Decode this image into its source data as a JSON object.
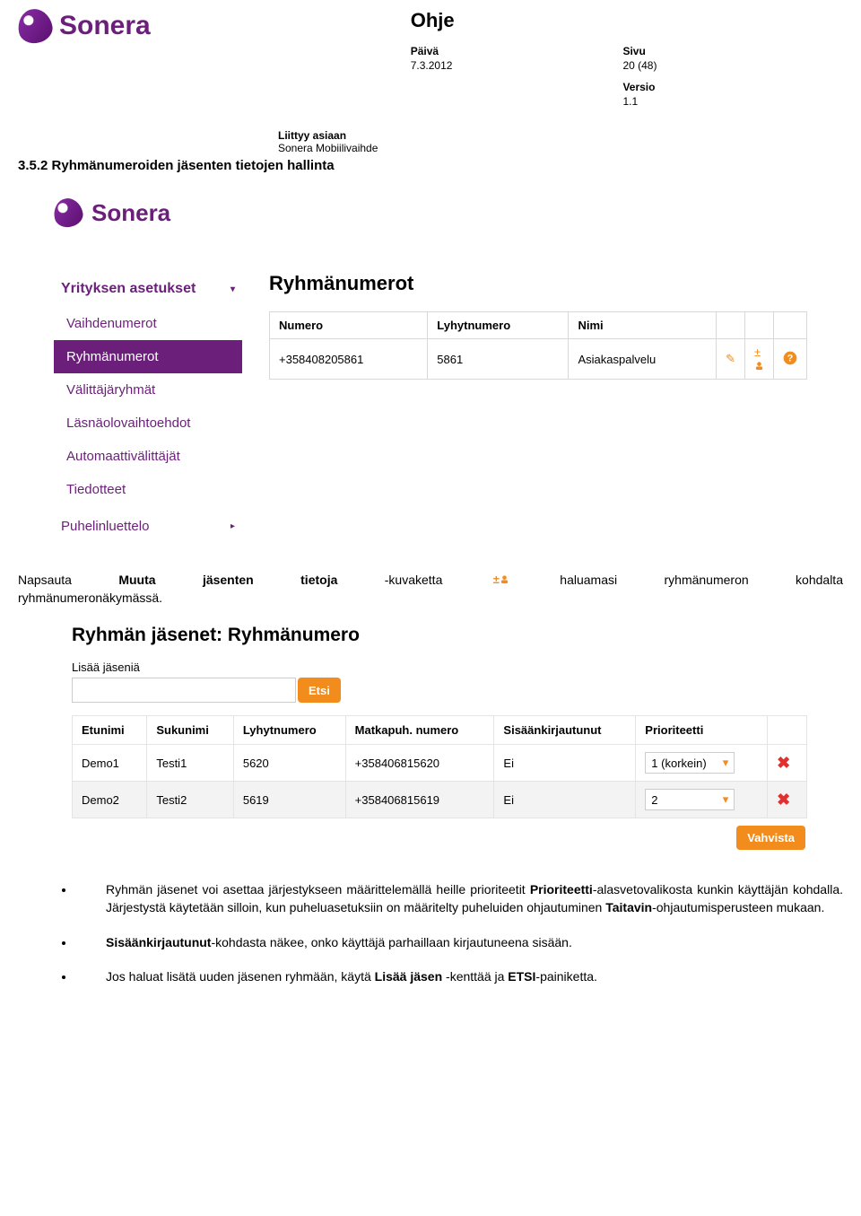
{
  "header": {
    "brand": "Sonera",
    "doc_title": "Ohje",
    "date_label": "Päivä",
    "date_value": "7.3.2012",
    "page_label": "Sivu",
    "page_value": "20 (48)",
    "version_label": "Versio",
    "version_value": "1.1",
    "relates_label": "Liittyy asiaan",
    "relates_value": "Sonera Mobiilivaihde"
  },
  "section_number": "3.5.2 Ryhmänumeroiden jäsenten tietojen hallinta",
  "shot1": {
    "brand": "Sonera",
    "sidebar_header": "Yrityksen asetukset",
    "sidebar_footer": "Puhelinluettelo",
    "sidebar_items": [
      "Vaihdenumerot",
      "Ryhmänumerot",
      "Välittäjäryhmät",
      "Läsnäolovaihtoehdot",
      "Automaattivälittäjät",
      "Tiedotteet"
    ],
    "content_title": "Ryhmänumerot",
    "table": {
      "headers": [
        "Numero",
        "Lyhytnumero",
        "Nimi"
      ],
      "row": {
        "numero": "+358408205861",
        "lyhyt": "5861",
        "nimi": "Asiakaspalvelu"
      }
    }
  },
  "para1": {
    "line_pre": "Napsauta",
    "w1": "Muuta",
    "w2": "jäsenten",
    "w3": "tietoja",
    "w4": "-kuvaketta",
    "w5": "haluamasi",
    "w6": "ryhmänumeron",
    "w7": "kohdalta",
    "line2": "ryhmänumeronäkymässä."
  },
  "shot2": {
    "title": "Ryhmän jäsenet: Ryhmänumero",
    "add_label": "Lisää jäseniä",
    "search_btn": "Etsi",
    "headers": [
      "Etunimi",
      "Sukunimi",
      "Lyhytnumero",
      "Matkapuh. numero",
      "Sisäänkirjautunut",
      "Prioriteetti"
    ],
    "rows": [
      {
        "etu": "Demo1",
        "suku": "Testi1",
        "lyhyt": "5620",
        "puh": "+358406815620",
        "sis": "Ei",
        "prio": "1 (korkein)"
      },
      {
        "etu": "Demo2",
        "suku": "Testi2",
        "lyhyt": "5619",
        "puh": "+358406815619",
        "sis": "Ei",
        "prio": "2"
      }
    ],
    "confirm": "Vahvista"
  },
  "bullets": {
    "b1_a": "Ryhmän jäsenet voi asettaa järjestykseen määrittelemällä heille prioriteetit ",
    "b1_b": "Prioriteetti",
    "b1_c": "-alasvetovalikosta kunkin käyttäjän kohdalla. Järjestystä käytetään silloin, kun puheluasetuksiin on määritelty puheluiden ohjautuminen ",
    "b1_d": "Taitavin",
    "b1_e": "-ohjautumisperusteen mukaan.",
    "b2_a": "Sisäänkirjautunut",
    "b2_b": "-kohdasta näkee, onko käyttäjä parhaillaan kirjautuneena sisään.",
    "b3_a": "Jos haluat lisätä uuden jäsenen ryhmään, käytä ",
    "b3_b": "Lisää jäsen",
    "b3_c": " -kenttää ja ",
    "b3_d": "ETSI",
    "b3_e": "-painiketta."
  },
  "icons": {
    "edit": "✎",
    "members": "±👤",
    "question": "?",
    "delete": "✖",
    "caret_down": "▾",
    "caret_right": "▸"
  }
}
